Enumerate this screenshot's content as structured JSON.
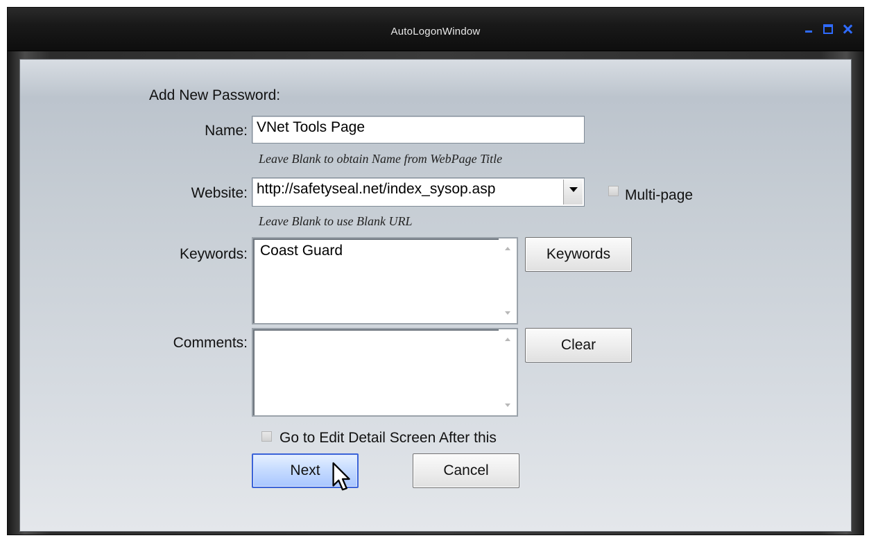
{
  "window": {
    "title": "AutoLogonWindow"
  },
  "form": {
    "heading": "Add New Password:",
    "name": {
      "label": "Name:",
      "value": "VNet Tools Page",
      "hint": "Leave Blank to obtain Name from WebPage Title"
    },
    "website": {
      "label": "Website:",
      "value": "http://safetyseal.net/index_sysop.asp",
      "hint": "Leave Blank to use Blank URL",
      "multipage_label": "Multi-page",
      "multipage_checked": false
    },
    "keywords": {
      "label": "Keywords:",
      "value": "Coast Guard",
      "button_label": "Keywords"
    },
    "comments": {
      "label": "Comments:",
      "value": "",
      "button_label": "Clear"
    },
    "edit_detail": {
      "label": "Go to Edit Detail Screen After this",
      "checked": false
    },
    "next_label": "Next",
    "cancel_label": "Cancel"
  },
  "icons": {
    "minimize": "minimize-icon",
    "maximize": "maximize-icon",
    "close": "close-icon",
    "dropdown": "chevron-down-icon",
    "cursor": "mouse-pointer-icon"
  },
  "colors": {
    "window_controls": "#2f6bff",
    "primary_button_border": "#3a63d8"
  }
}
